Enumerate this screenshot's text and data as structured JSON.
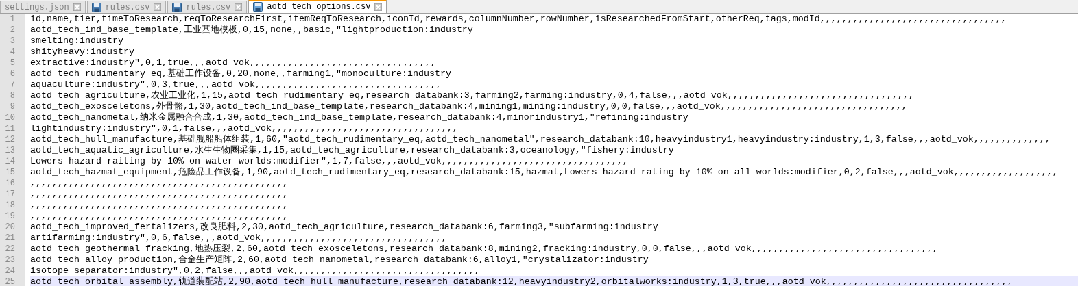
{
  "tabs": [
    {
      "label": "settings.json",
      "selected": false,
      "icon_visible": false
    },
    {
      "label": "rules.csv",
      "selected": false,
      "icon_visible": true
    },
    {
      "label": "rules.csv",
      "selected": false,
      "icon_visible": true
    },
    {
      "label": "aotd_tech_options.csv",
      "selected": true,
      "icon_visible": true
    }
  ],
  "lines": [
    {
      "number": "1",
      "text": "id,name,tier,timeToResearch,reqToResearchFirst,itemReqToResearch,iconId,rewards,columnNumber,rowNumber,isResearchedFromStart,otherReq,tags,modId,,,,,,,,,,,,,,,,,,,,,,,,,,,,,,,,,,",
      "current": false
    },
    {
      "number": "2",
      "text": "aotd_tech_ind_base_template,工业基地模板,0,15,none,,basic,\"lightproduction:industry",
      "current": false
    },
    {
      "number": "3",
      "text": "smelting:industry",
      "current": false
    },
    {
      "number": "4",
      "text": "shityheavy:industry",
      "current": false
    },
    {
      "number": "5",
      "text": "extractive:industry\",0,1,true,,,aotd_vok,,,,,,,,,,,,,,,,,,,,,,,,,,,,,,,,,,",
      "current": false
    },
    {
      "number": "6",
      "text": "aotd_tech_rudimentary_eq,基础工作设备,0,20,none,,farming1,\"monoculture:industry",
      "current": false
    },
    {
      "number": "7",
      "text": "aquaculture:industry\",0,3,true,,,aotd_vok,,,,,,,,,,,,,,,,,,,,,,,,,,,,,,,,,,",
      "current": false
    },
    {
      "number": "8",
      "text": "aotd_tech_agriculture,农业工业化,1,15,aotd_tech_rudimentary_eq,research_databank:3,farming2,farming:industry,0,4,false,,,aotd_vok,,,,,,,,,,,,,,,,,,,,,,,,,,,,,,,,,,",
      "current": false
    },
    {
      "number": "9",
      "text": "aotd_tech_exosceletons,外骨骼,1,30,aotd_tech_ind_base_template,research_databank:4,mining1,mining:industry,0,0,false,,,aotd_vok,,,,,,,,,,,,,,,,,,,,,,,,,,,,,,,,,,",
      "current": false
    },
    {
      "number": "10",
      "text": "aotd_tech_nanometal,纳米金属融合合成,1,30,aotd_tech_ind_base_template,research_databank:4,minorindustry1,\"refining:industry",
      "current": false
    },
    {
      "number": "11",
      "text": "lightindustry:industry\",0,1,false,,,aotd_vok,,,,,,,,,,,,,,,,,,,,,,,,,,,,,,,,,,",
      "current": false
    },
    {
      "number": "12",
      "text": "aotd_tech_hull_manufacture,基础舰船船体组装,1,60,\"aotd_tech_rudimentary_eq,aotd_tech_nanometal\",research_databank:10,heavyindustry1,heavyindustry:industry,1,3,false,,,aotd_vok,,,,,,,,,,,,,,",
      "current": false
    },
    {
      "number": "13",
      "text": "aotd_tech_aquatic_agriculture,水生生物圈采集,1,15,aotd_tech_agriculture,research_databank:3,oceanology,\"fishery:industry",
      "current": false
    },
    {
      "number": "14",
      "text": "Lowers hazard raiting by 10% on water worlds:modifier\",1,7,false,,,aotd_vok,,,,,,,,,,,,,,,,,,,,,,,,,,,,,,,,,,",
      "current": false
    },
    {
      "number": "15",
      "text": "aotd_tech_hazmat_equipment,危险品工作设备,1,90,aotd_tech_rudimentary_eq,research_databank:15,hazmat,Lowers hazard rating by 10% on all worlds:modifier,0,2,false,,,aotd_vok,,,,,,,,,,,,,,,,,,,",
      "current": false
    },
    {
      "number": "16",
      "text": ",,,,,,,,,,,,,,,,,,,,,,,,,,,,,,,,,,,,,,,,,,,,,,,",
      "current": false
    },
    {
      "number": "17",
      "text": ",,,,,,,,,,,,,,,,,,,,,,,,,,,,,,,,,,,,,,,,,,,,,,,",
      "current": false
    },
    {
      "number": "18",
      "text": ",,,,,,,,,,,,,,,,,,,,,,,,,,,,,,,,,,,,,,,,,,,,,,,",
      "current": false
    },
    {
      "number": "19",
      "text": ",,,,,,,,,,,,,,,,,,,,,,,,,,,,,,,,,,,,,,,,,,,,,,,",
      "current": false
    },
    {
      "number": "20",
      "text": "aotd_tech_improved_fertalizers,改良肥料,2,30,aotd_tech_agriculture,research_databank:6,farming3,\"subfarming:industry",
      "current": false
    },
    {
      "number": "21",
      "text": "artifarming:industry\",0,6,false,,,aotd_vok,,,,,,,,,,,,,,,,,,,,,,,,,,,,,,,,,,",
      "current": false
    },
    {
      "number": "22",
      "text": "aotd_tech_geothermal_fracking,地热压裂,2,60,aotd_tech_exosceletons,research_databank:8,mining2,fracking:industry,0,0,false,,,aotd_vok,,,,,,,,,,,,,,,,,,,,,,,,,,,,,,,,,,",
      "current": false
    },
    {
      "number": "23",
      "text": "aotd_tech_alloy_production,合金生产矩阵,2,60,aotd_tech_nanometal,research_databank:6,alloy1,\"crystalizator:industry",
      "current": false
    },
    {
      "number": "24",
      "text": "isotope_separator:industry\",0,2,false,,,aotd_vok,,,,,,,,,,,,,,,,,,,,,,,,,,,,,,,,,,",
      "current": false
    },
    {
      "number": "25",
      "text": "aotd_tech_orbital_assembly,轨道装配站,2,90,aotd_tech_hull_manufacture,research_databank:12,heavyindustry2,orbitalworks:industry,1,3,true,,,aotd_vok,,,,,,,,,,,,,,,,,,,,,,,,,,,,,,,,,,",
      "current": true
    }
  ]
}
